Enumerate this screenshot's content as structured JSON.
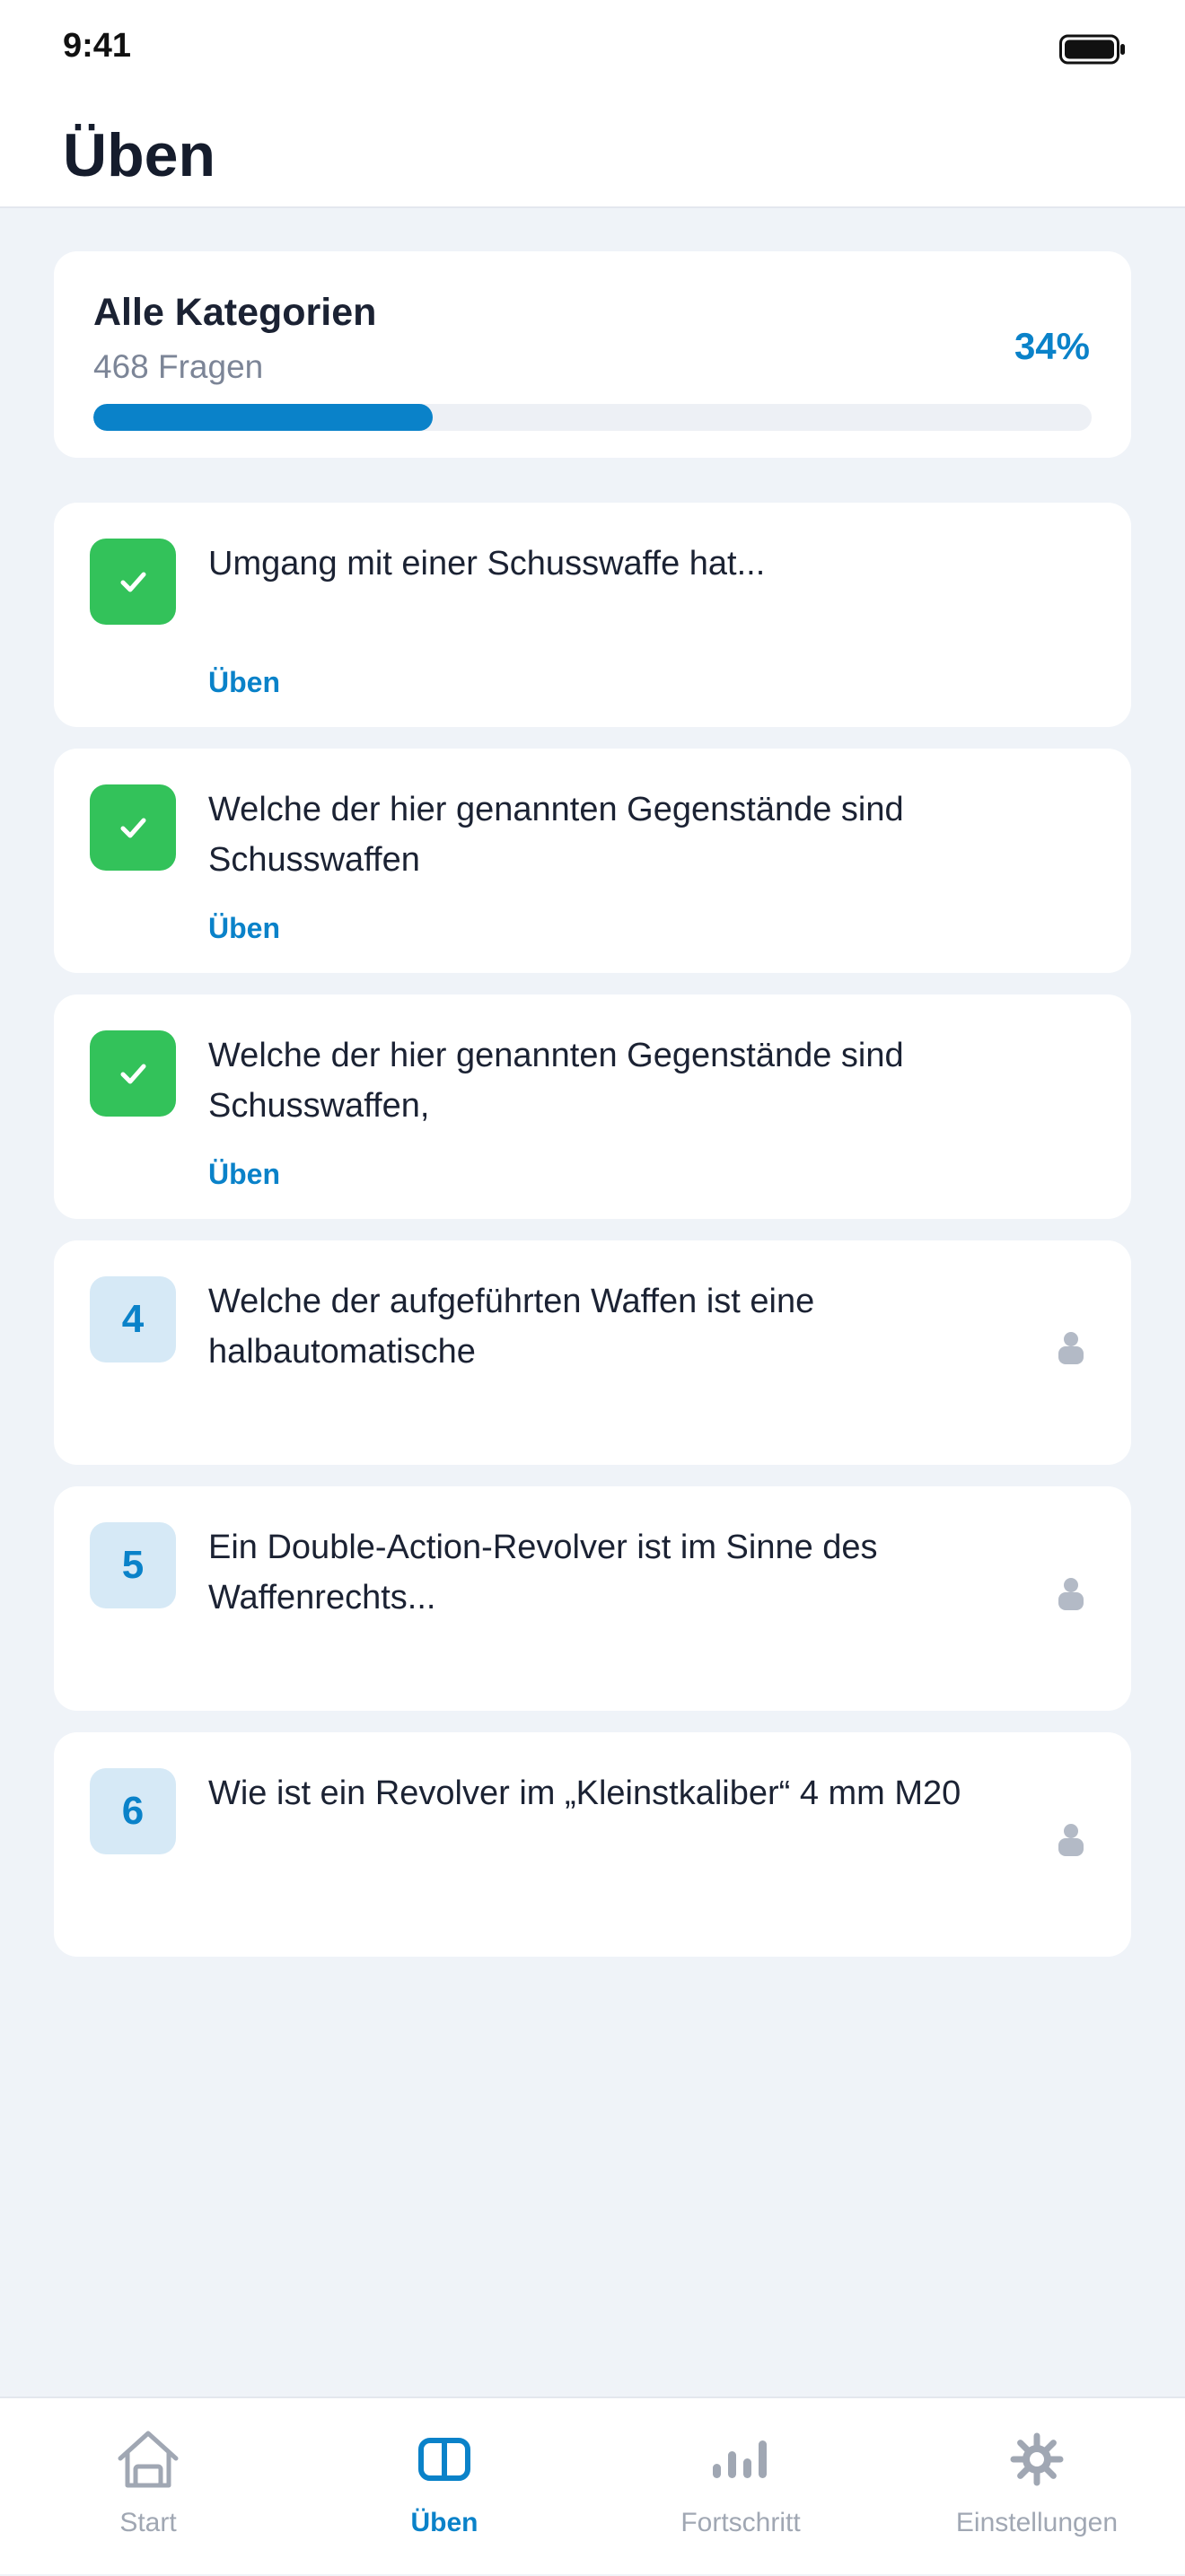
{
  "status_bar": {
    "time": "9:41",
    "battery_icon": "battery-icon"
  },
  "header": {
    "title": "Üben"
  },
  "summary": {
    "title": "Alle Kategorien",
    "count": "468 Fragen",
    "percent_label": "34%",
    "progress": 0.34
  },
  "questions": [
    {
      "status": "done",
      "icon": "check-icon",
      "text": "Umgang mit einer Schusswaffe hat...",
      "action": "Üben"
    },
    {
      "status": "done",
      "icon": "check-icon",
      "text": "Welche der hier genannten Gegenstände sind Schusswaffen",
      "action": "Üben"
    },
    {
      "status": "done",
      "icon": "check-icon",
      "text": "Welche der hier genannten Gegenstände sind Schusswaffen,",
      "action": "Üben"
    },
    {
      "status": "locked",
      "number": "4",
      "icon": "lock-icon",
      "text": "Welche der aufgeführten Waffen ist eine halbautomatische"
    },
    {
      "status": "locked",
      "number": "5",
      "icon": "lock-icon",
      "text": "Ein Double-Action-Revolver ist im Sinne des Waffenrechts..."
    },
    {
      "status": "locked",
      "number": "6",
      "icon": "lock-icon",
      "text": "Wie ist ein Revolver im „Kleinstkaliber“ 4 mm M20"
    }
  ],
  "tabbar": {
    "items": [
      {
        "label": "Start",
        "icon": "home-icon",
        "active": false
      },
      {
        "label": "Üben",
        "icon": "book-icon",
        "active": true
      },
      {
        "label": "Fortschritt",
        "icon": "bar-chart-icon",
        "active": false
      },
      {
        "label": "Einstellungen",
        "icon": "gear-icon",
        "active": false
      }
    ]
  },
  "colors": {
    "accent": "#0a82c9",
    "success": "#33c25a",
    "background": "#eff3f8",
    "muted": "#a0a7b3"
  }
}
